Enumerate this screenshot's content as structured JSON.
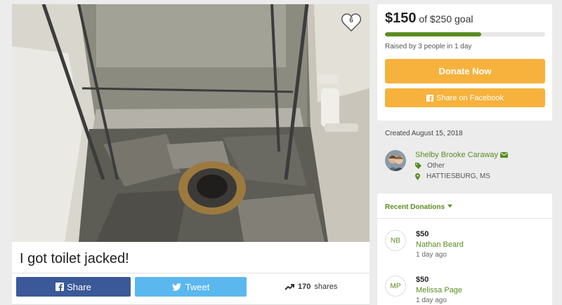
{
  "campaign": {
    "title": "I got toilet jacked!",
    "heart_count": "6"
  },
  "share": {
    "facebook_label": "Share",
    "tweet_label": "Tweet",
    "shares_count": "170",
    "shares_label": "shares"
  },
  "goal": {
    "raised": "$150",
    "goal_text": "of $250 goal",
    "progress_fraction": 0.6,
    "raised_by": "Raised by 3 people in 1 day",
    "donate_label": "Donate Now",
    "share_facebook_label": "Share on Facebook"
  },
  "created": "Created August 15, 2018",
  "organizer": {
    "name": "Shelby Brooke Caraway",
    "category": "Other",
    "location": "HATTIESBURG, MS"
  },
  "recent": {
    "heading": "Recent Donations",
    "donations": [
      {
        "initials": "NB",
        "amount": "$50",
        "name": "Nathan Beard",
        "time": "1 day ago"
      },
      {
        "initials": "MP",
        "amount": "$50",
        "name": "Melissa Page",
        "time": "1 day ago"
      }
    ]
  },
  "colors": {
    "accent_green": "#5a8c21",
    "donate_orange": "#f6b23c",
    "facebook_blue": "#3b5998",
    "twitter_blue": "#5bb8ee"
  }
}
